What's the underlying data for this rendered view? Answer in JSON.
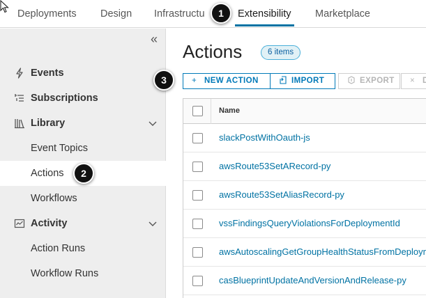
{
  "topnav": {
    "tabs": [
      {
        "label": "Deployments",
        "active": false
      },
      {
        "label": "Design",
        "active": false
      },
      {
        "label": "Infrastructu",
        "active": false
      },
      {
        "label": "Extensibility",
        "active": true
      },
      {
        "label": "Marketplace",
        "active": false
      }
    ]
  },
  "sidebar": {
    "collapse_icon": "double-chevron-left-icon",
    "items": [
      {
        "label": "Events",
        "icon": "lightning-icon",
        "group": true
      },
      {
        "label": "Subscriptions",
        "icon": "subscriptions-icon",
        "group": true
      },
      {
        "label": "Library",
        "icon": "library-icon",
        "group": true,
        "expanded": true
      },
      {
        "label": "Event Topics"
      },
      {
        "label": "Actions",
        "active": true
      },
      {
        "label": "Workflows"
      },
      {
        "label": "Activity",
        "icon": "activity-icon",
        "group": true,
        "expanded": true
      },
      {
        "label": "Action Runs"
      },
      {
        "label": "Workflow Runs"
      }
    ]
  },
  "main": {
    "title": "Actions",
    "count_badge": "6 items",
    "toolbar": {
      "new_action": "NEW ACTION",
      "import": "IMPORT",
      "export": "EXPORT",
      "delete_partial": "D"
    },
    "grid": {
      "column_name": "Name",
      "rows": [
        "slackPostWithOauth-js",
        "awsRoute53SetARecord-py",
        "awsRoute53SetAliasRecord-py",
        "vssFindingsQueryViolationsForDeploymentId",
        "awsAutoscalingGetGroupHealthStatusFromDeployment",
        "casBlueprintUpdateAndVersionAndRelease-py"
      ]
    }
  },
  "callouts": [
    "1",
    "2",
    "3"
  ],
  "colors": {
    "accent": "#0072a3",
    "sidebar_bg": "#eeeeee",
    "badge_bg": "#e1f1f6"
  }
}
